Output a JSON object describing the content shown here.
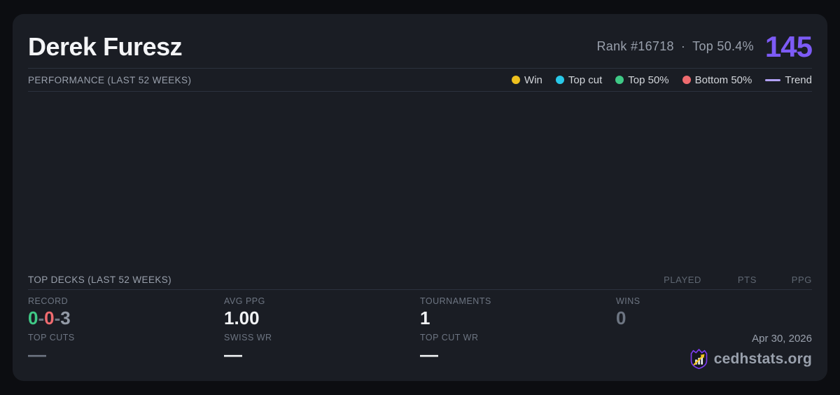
{
  "header": {
    "player_name": "Derek Furesz",
    "rank_label": "Rank #16718",
    "separator": "·",
    "top_percent_label": "Top 50.4%",
    "score": "145"
  },
  "performance": {
    "title": "PERFORMANCE (LAST 52 WEEKS)",
    "legend": {
      "win": {
        "label": "Win",
        "color": "#efc11e"
      },
      "top_cut": {
        "label": "Top cut",
        "color": "#29c8e8"
      },
      "top50": {
        "label": "Top 50%",
        "color": "#3fc986"
      },
      "bottom50": {
        "label": "Bottom 50%",
        "color": "#ef6b6f"
      },
      "trend": {
        "label": "Trend",
        "color": "#b2a1f7"
      }
    },
    "data_points": []
  },
  "top_decks": {
    "title": "TOP DECKS (LAST 52 WEEKS)",
    "columns": {
      "played": "PLAYED",
      "pts": "PTS",
      "ppg": "PPG"
    },
    "rows": []
  },
  "stats": {
    "record": {
      "label": "RECORD",
      "wins": "0",
      "losses": "0",
      "draws": "3",
      "sep": "-"
    },
    "avg_ppg": {
      "label": "AVG PPG",
      "value": "1.00"
    },
    "tournaments": {
      "label": "TOURNAMENTS",
      "value": "1"
    },
    "wins": {
      "label": "WINS",
      "value": "0"
    },
    "top_cuts": {
      "label": "TOP CUTS",
      "value": "—"
    },
    "swiss_wr": {
      "label": "SWISS WR",
      "value": "—"
    },
    "top_cut_wr": {
      "label": "TOP CUT WR",
      "value": "—"
    }
  },
  "footer": {
    "date": "Apr 30, 2026",
    "site": "cedhstats.org"
  },
  "colors": {
    "page_bg": "#0c0d11",
    "card_bg": "#1a1d24",
    "divider": "#2c323e",
    "accent_purple": "#7d5bf6",
    "logo_purple": "#7c3aed",
    "logo_gold": "#f2c21d",
    "text_bright": "#f0f2f4",
    "text_muted": "#99a0ac",
    "text_dim": "#6d7582",
    "win_green": "#3fc986",
    "loss_red": "#ef6b6f"
  }
}
